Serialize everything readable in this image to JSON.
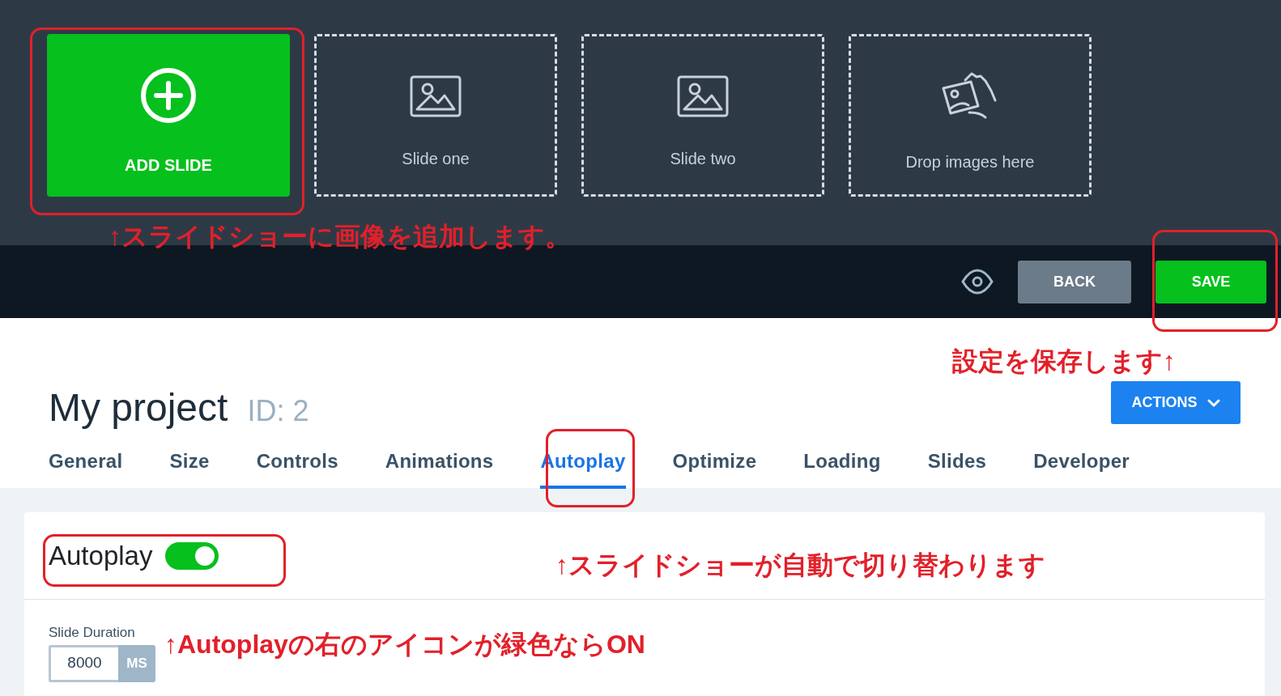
{
  "slides": [
    {
      "kind": "add",
      "label": "ADD SLIDE"
    },
    {
      "kind": "slide",
      "label": "Slide one"
    },
    {
      "kind": "slide",
      "label": "Slide two"
    },
    {
      "kind": "drop",
      "label": "Drop images here"
    }
  ],
  "toolbar": {
    "back": "BACK",
    "save": "SAVE"
  },
  "project": {
    "title": "My project",
    "id_label": "ID: 2",
    "actions": "ACTIONS"
  },
  "tabs": [
    {
      "label": "General",
      "selected": false
    },
    {
      "label": "Size",
      "selected": false
    },
    {
      "label": "Controls",
      "selected": false
    },
    {
      "label": "Animations",
      "selected": false
    },
    {
      "label": "Autoplay",
      "selected": true
    },
    {
      "label": "Optimize",
      "selected": false
    },
    {
      "label": "Loading",
      "selected": false
    },
    {
      "label": "Slides",
      "selected": false
    },
    {
      "label": "Developer",
      "selected": false
    }
  ],
  "autoplay": {
    "label": "Autoplay",
    "on": true
  },
  "slide_duration": {
    "label": "Slide Duration",
    "value": "8000",
    "unit": "MS"
  },
  "annotations": [
    "↑スライドショーに画像を追加します。",
    "設定を保存します↑",
    "↑スライドショーが自動で切り替わります",
    "↑Autoplayの右のアイコンが緑色ならON"
  ]
}
